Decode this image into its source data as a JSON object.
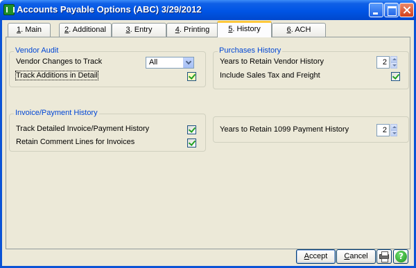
{
  "window": {
    "title": "Accounts Payable Options (ABC) 3/29/2012"
  },
  "tabs": [
    {
      "key": "1",
      "label": ". Main"
    },
    {
      "key": "2",
      "label": ". Additional"
    },
    {
      "key": "3",
      "label": ". Entry"
    },
    {
      "key": "4",
      "label": ". Printing"
    },
    {
      "key": "5",
      "label": ". History"
    },
    {
      "key": "6",
      "label": ". ACH"
    }
  ],
  "active_tab": "5. History",
  "vendor_audit": {
    "title": "Vendor Audit",
    "changes_label": "Vendor Changes to Track",
    "changes_value": "All",
    "track_additions_label": "Track Additions in Detail",
    "track_additions_checked": true
  },
  "invoice_history": {
    "title": "Invoice/Payment History",
    "track_detailed_label": "Track Detailed Invoice/Payment History",
    "track_detailed_checked": true,
    "retain_comment_label": "Retain Comment Lines for Invoices",
    "retain_comment_checked": true
  },
  "purchases_history": {
    "title": "Purchases History",
    "years_vendor_label": "Years to Retain Vendor History",
    "years_vendor_value": "2",
    "include_tax_label": "Include Sales Tax and Freight",
    "include_tax_checked": true
  },
  "history_1099": {
    "years_label": "Years to Retain 1099 Payment History",
    "years_value": "2"
  },
  "buttons": {
    "accept_key": "A",
    "accept_rest": "ccept",
    "cancel_key": "C",
    "cancel_rest": "ancel",
    "help_glyph": "?"
  }
}
